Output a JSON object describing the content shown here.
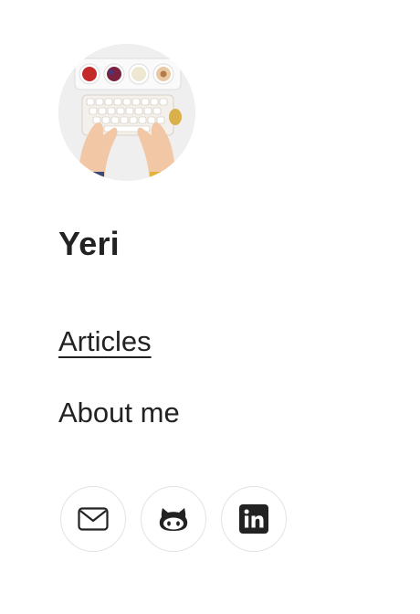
{
  "profile": {
    "name": "Yeri",
    "avatar_icon": "avatar-typewriter-photo"
  },
  "nav": {
    "items": [
      {
        "label": "Articles",
        "active": true
      },
      {
        "label": "About me",
        "active": false
      }
    ]
  },
  "social": [
    {
      "icon": "mail-icon"
    },
    {
      "icon": "github-icon"
    },
    {
      "icon": "linkedin-icon"
    }
  ],
  "colors": {
    "text": "#222222",
    "border": "#e3e3e3",
    "background": "#ffffff"
  }
}
